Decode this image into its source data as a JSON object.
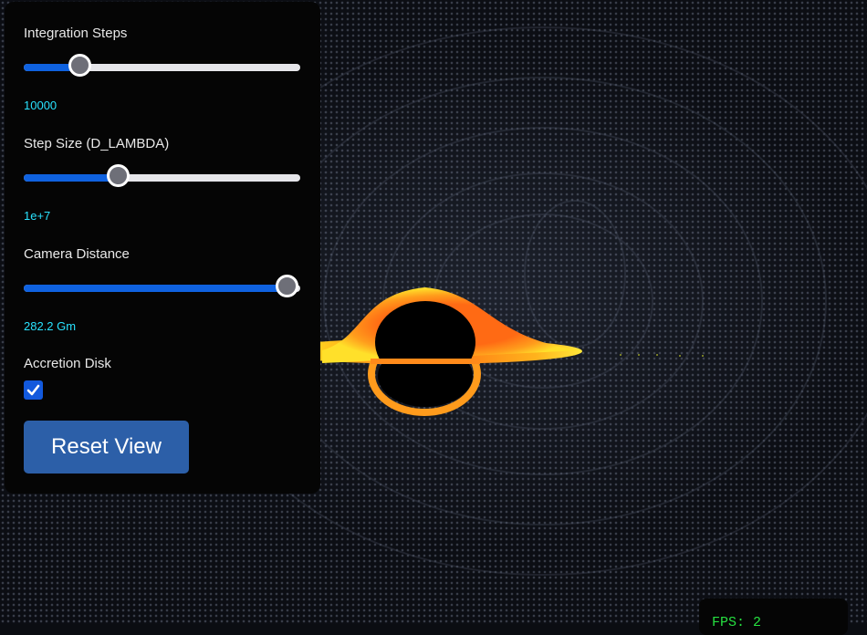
{
  "controls": {
    "integration_steps": {
      "label": "Integration Steps",
      "value": "10000",
      "slider_fraction": 0.21
    },
    "step_size": {
      "label": "Step Size (D_LAMBDA)",
      "value": "1e+7",
      "slider_fraction": 0.35
    },
    "camera_distance": {
      "label": "Camera Distance",
      "value": "282.2 Gm",
      "slider_fraction": 0.96
    },
    "accretion_disk": {
      "label": "Accretion Disk",
      "checked": true
    },
    "reset_label": "Reset View"
  },
  "stats": {
    "fps": "FPS: 2"
  },
  "colors": {
    "accent": "#0f62e0",
    "value_text": "#29e3ff",
    "button": "#2c5fa8",
    "fps_text": "#26e040",
    "disk_inner": "#ffd21f",
    "disk_outer": "#ff7a1a"
  }
}
